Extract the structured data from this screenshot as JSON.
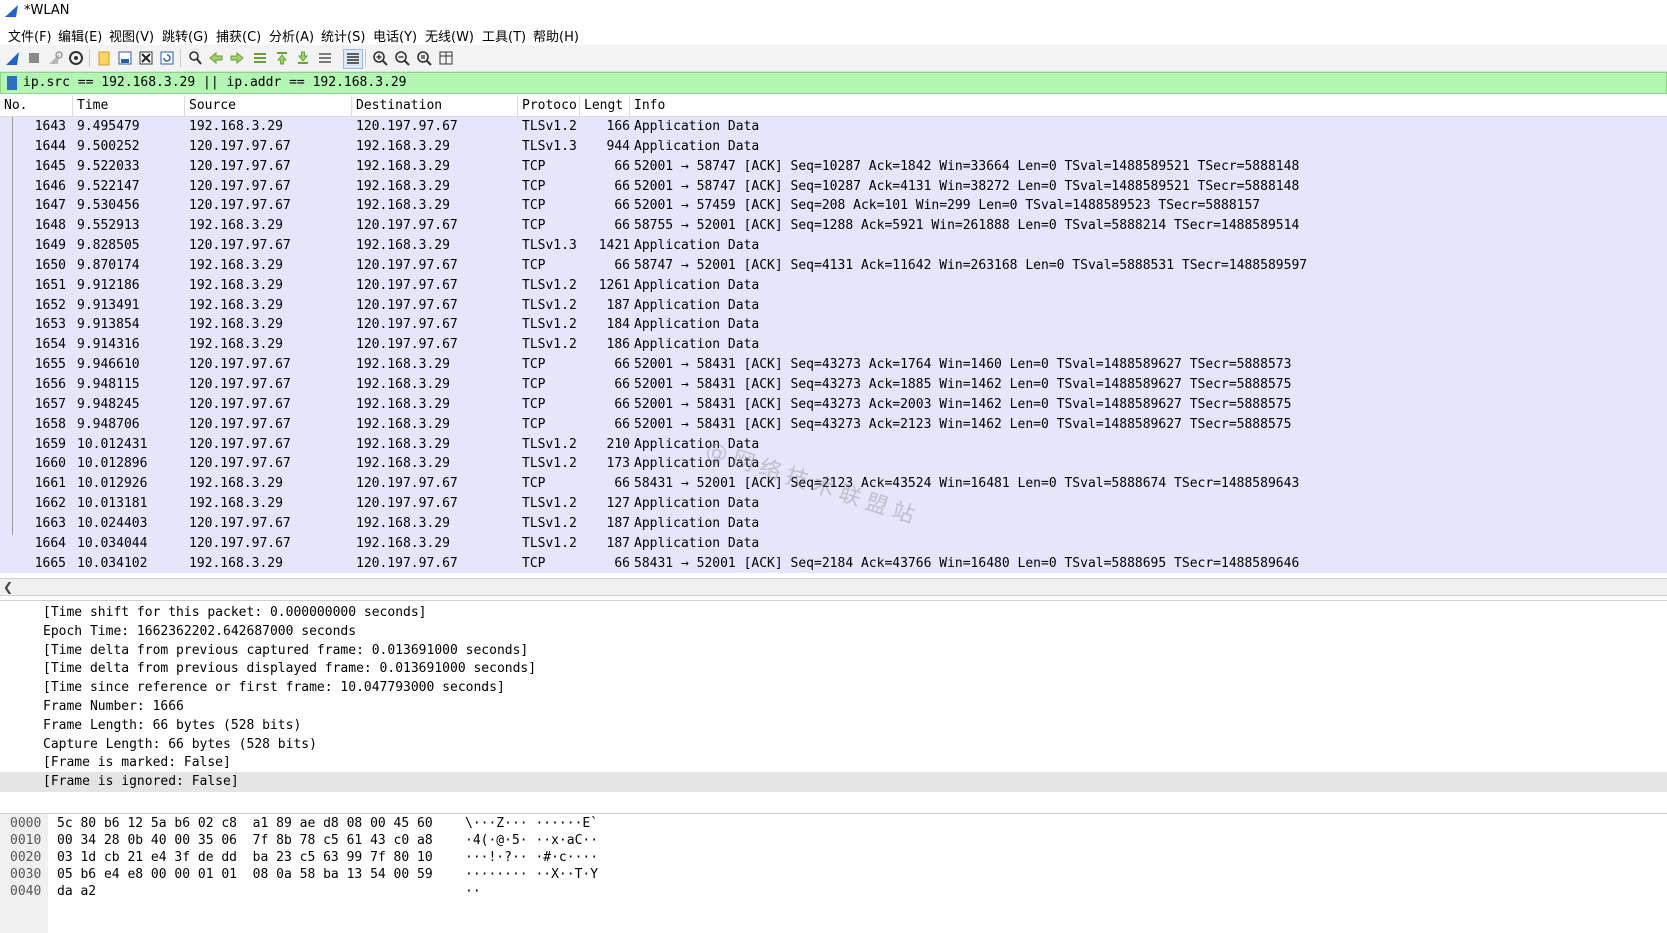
{
  "window": {
    "title": "*WLAN"
  },
  "menu": [
    "文件(F)",
    "编辑(E)",
    "视图(V)",
    "跳转(G)",
    "捕获(C)",
    "分析(A)",
    "统计(S)",
    "电话(Y)",
    "无线(W)",
    "工具(T)",
    "帮助(H)"
  ],
  "toolbar": {
    "icons": [
      "start-capture-icon",
      "stop-capture-icon",
      "restart-capture-icon",
      "capture-options-icon",
      "open-file-icon",
      "save-file-icon",
      "close-file-icon",
      "reload-file-icon",
      "find-packet-icon",
      "go-back-icon",
      "go-forward-icon",
      "go-to-packet-icon",
      "go-first-icon",
      "go-last-icon",
      "auto-scroll-icon",
      "colorize-icon",
      "zoom-in-icon",
      "zoom-out-icon",
      "zoom-normal-icon",
      "resize-columns-icon"
    ]
  },
  "filter": {
    "value": "ip.src == 192.168.3.29 || ip.addr == 192.168.3.29",
    "background": "#b3f5b3"
  },
  "packet_list": {
    "columns": [
      "No.",
      "Time",
      "Source",
      "Destination",
      "Protoco",
      "Lengt",
      "Info"
    ],
    "row_color": "#e5e5fb",
    "rows": [
      [
        "1643",
        "9.495479",
        "192.168.3.29",
        "120.197.97.67",
        "TLSv1.2",
        "166",
        "Application Data"
      ],
      [
        "1644",
        "9.500252",
        "120.197.97.67",
        "192.168.3.29",
        "TLSv1.3",
        "944",
        "Application Data"
      ],
      [
        "1645",
        "9.522033",
        "120.197.97.67",
        "192.168.3.29",
        "TCP",
        "66",
        "52001 → 58747 [ACK] Seq=10287 Ack=1842 Win=33664 Len=0 TSval=1488589521 TSecr=5888148"
      ],
      [
        "1646",
        "9.522147",
        "120.197.97.67",
        "192.168.3.29",
        "TCP",
        "66",
        "52001 → 58747 [ACK] Seq=10287 Ack=4131 Win=38272 Len=0 TSval=1488589521 TSecr=5888148"
      ],
      [
        "1647",
        "9.530456",
        "120.197.97.67",
        "192.168.3.29",
        "TCP",
        "66",
        "52001 → 57459 [ACK] Seq=208 Ack=101 Win=299 Len=0 TSval=1488589523 TSecr=5888157"
      ],
      [
        "1648",
        "9.552913",
        "192.168.3.29",
        "120.197.97.67",
        "TCP",
        "66",
        "58755 → 52001 [ACK] Seq=1288 Ack=5921 Win=261888 Len=0 TSval=5888214 TSecr=1488589514"
      ],
      [
        "1649",
        "9.828505",
        "120.197.97.67",
        "192.168.3.29",
        "TLSv1.3",
        "1421",
        "Application Data"
      ],
      [
        "1650",
        "9.870174",
        "192.168.3.29",
        "120.197.97.67",
        "TCP",
        "66",
        "58747 → 52001 [ACK] Seq=4131 Ack=11642 Win=263168 Len=0 TSval=5888531 TSecr=1488589597"
      ],
      [
        "1651",
        "9.912186",
        "192.168.3.29",
        "120.197.97.67",
        "TLSv1.2",
        "1261",
        "Application Data"
      ],
      [
        "1652",
        "9.913491",
        "192.168.3.29",
        "120.197.97.67",
        "TLSv1.2",
        "187",
        "Application Data"
      ],
      [
        "1653",
        "9.913854",
        "192.168.3.29",
        "120.197.97.67",
        "TLSv1.2",
        "184",
        "Application Data"
      ],
      [
        "1654",
        "9.914316",
        "192.168.3.29",
        "120.197.97.67",
        "TLSv1.2",
        "186",
        "Application Data"
      ],
      [
        "1655",
        "9.946610",
        "120.197.97.67",
        "192.168.3.29",
        "TCP",
        "66",
        "52001 → 58431 [ACK] Seq=43273 Ack=1764 Win=1460 Len=0 TSval=1488589627 TSecr=5888573"
      ],
      [
        "1656",
        "9.948115",
        "120.197.97.67",
        "192.168.3.29",
        "TCP",
        "66",
        "52001 → 58431 [ACK] Seq=43273 Ack=1885 Win=1462 Len=0 TSval=1488589627 TSecr=5888575"
      ],
      [
        "1657",
        "9.948245",
        "120.197.97.67",
        "192.168.3.29",
        "TCP",
        "66",
        "52001 → 58431 [ACK] Seq=43273 Ack=2003 Win=1462 Len=0 TSval=1488589627 TSecr=5888575"
      ],
      [
        "1658",
        "9.948706",
        "120.197.97.67",
        "192.168.3.29",
        "TCP",
        "66",
        "52001 → 58431 [ACK] Seq=43273 Ack=2123 Win=1462 Len=0 TSval=1488589627 TSecr=5888575"
      ],
      [
        "1659",
        "10.012431",
        "120.197.97.67",
        "192.168.3.29",
        "TLSv1.2",
        "210",
        "Application Data"
      ],
      [
        "1660",
        "10.012896",
        "120.197.97.67",
        "192.168.3.29",
        "TLSv1.2",
        "173",
        "Application Data"
      ],
      [
        "1661",
        "10.012926",
        "192.168.3.29",
        "120.197.97.67",
        "TCP",
        "66",
        "58431 → 52001 [ACK] Seq=2123 Ack=43524 Win=16481 Len=0 TSval=5888674 TSecr=1488589643"
      ],
      [
        "1662",
        "10.013181",
        "192.168.3.29",
        "120.197.97.67",
        "TLSv1.2",
        "127",
        "Application Data"
      ],
      [
        "1663",
        "10.024403",
        "120.197.97.67",
        "192.168.3.29",
        "TLSv1.2",
        "187",
        "Application Data"
      ],
      [
        "1664",
        "10.034044",
        "120.197.97.67",
        "192.168.3.29",
        "TLSv1.2",
        "187",
        "Application Data"
      ],
      [
        "1665",
        "10.034102",
        "192.168.3.29",
        "120.197.97.67",
        "TCP",
        "66",
        "58431 → 52001 [ACK] Seq=2184 Ack=43766 Win=16480 Len=0 TSval=5888695 TSecr=1488589646"
      ]
    ]
  },
  "details": {
    "lines": [
      "[Time shift for this packet: 0.000000000 seconds]",
      "Epoch Time: 1662362202.642687000 seconds",
      "[Time delta from previous captured frame: 0.013691000 seconds]",
      "[Time delta from previous displayed frame: 0.013691000 seconds]",
      "[Time since reference or first frame: 10.047793000 seconds]",
      "Frame Number: 1666",
      "Frame Length: 66 bytes (528 bits)",
      "Capture Length: 66 bytes (528 bits)",
      "[Frame is marked: False]",
      "[Frame is ignored: False]"
    ],
    "selected_index": 9
  },
  "bytes": {
    "lines": [
      {
        "offset": "0000",
        "hex": "5c 80 b6 12 5a b6 02 c8  a1 89 ae d8 08 00 45 60",
        "ascii": "\\···Z··· ······E`"
      },
      {
        "offset": "0010",
        "hex": "00 34 28 0b 40 00 35 06  7f 8b 78 c5 61 43 c0 a8",
        "ascii": "·4(·@·5· ··x·aC··"
      },
      {
        "offset": "0020",
        "hex": "03 1d cb 21 e4 3f de dd  ba 23 c5 63 99 7f 80 10",
        "ascii": "···!·?·· ·#·c····"
      },
      {
        "offset": "0030",
        "hex": "05 b6 e4 e8 00 00 01 01  08 0a 58 ba 13 54 00 59",
        "ascii": "········ ··X··T·Y"
      },
      {
        "offset": "0040",
        "hex": "da a2",
        "ascii": "··"
      }
    ]
  },
  "watermark": "@网络技术联盟站"
}
